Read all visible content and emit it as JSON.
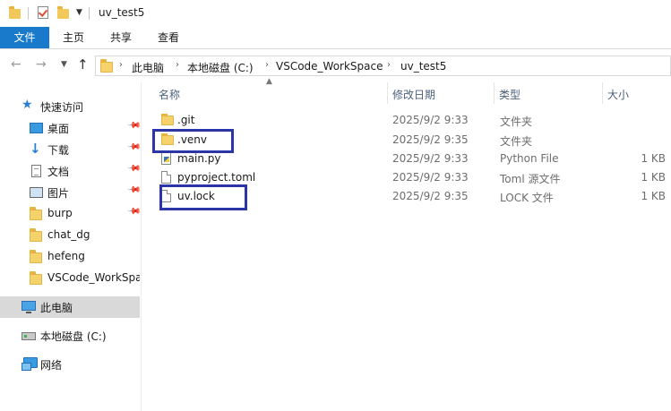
{
  "window": {
    "title": "uv_test5"
  },
  "ribbon": {
    "tabs": [
      "文件",
      "主页",
      "共享",
      "查看"
    ]
  },
  "address": {
    "crumbs": [
      "此电脑",
      "本地磁盘 (C:)",
      "VSCode_WorkSpace",
      "uv_test5"
    ]
  },
  "sidebar": {
    "quick_access": "快速访问",
    "quick_items": [
      "桌面",
      "下载",
      "文档",
      "图片",
      "burp",
      "chat_dg",
      "hefeng",
      "VSCode_WorkSpa"
    ],
    "this_pc": "此电脑",
    "local_disk": "本地磁盘 (C:)",
    "network": "网络"
  },
  "columns": {
    "name": "名称",
    "modified": "修改日期",
    "type": "类型",
    "size": "大小"
  },
  "files": [
    {
      "name": ".git",
      "modified": "2025/9/2 9:33",
      "type": "文件夹",
      "size": "",
      "icon": "folder-icon"
    },
    {
      "name": ".venv",
      "modified": "2025/9/2 9:35",
      "type": "文件夹",
      "size": "",
      "icon": "folder-icon"
    },
    {
      "name": "main.py",
      "modified": "2025/9/2 9:33",
      "type": "Python File",
      "size": "1 KB",
      "icon": "python-file-icon"
    },
    {
      "name": "pyproject.toml",
      "modified": "2025/9/2 9:33",
      "type": "Toml 源文件",
      "size": "1 KB",
      "icon": "file-icon"
    },
    {
      "name": "uv.lock",
      "modified": "2025/9/2 9:35",
      "type": "LOCK 文件",
      "size": "1 KB",
      "icon": "file-icon"
    }
  ],
  "colors": {
    "accent": "#1979ca",
    "highlight_box": "#2b35a8",
    "selected_nav": "#d9d9d9"
  }
}
